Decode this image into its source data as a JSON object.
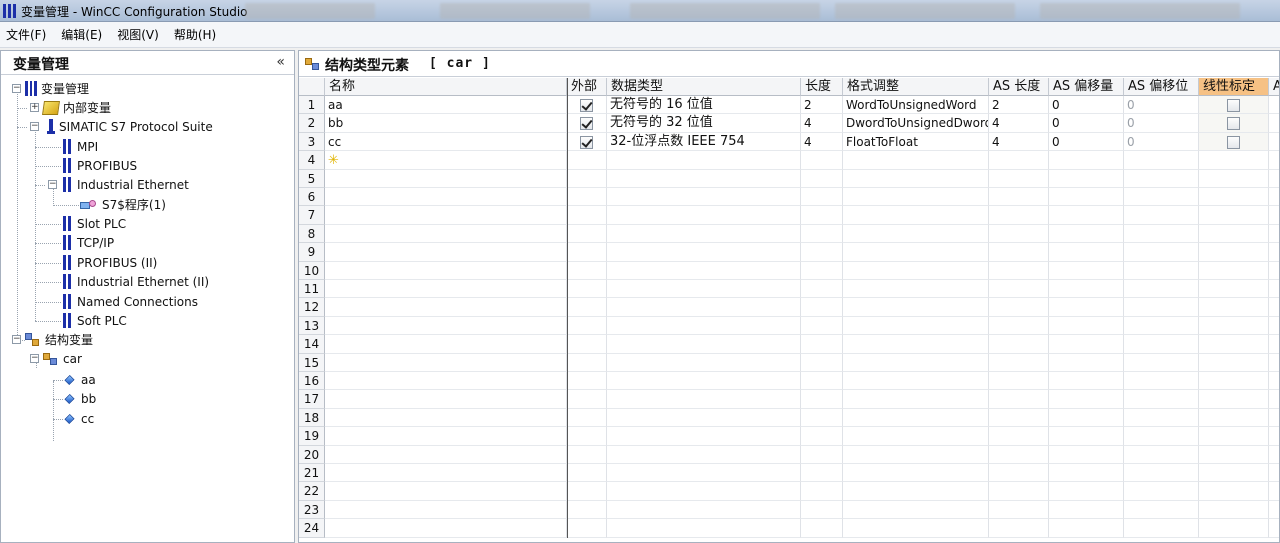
{
  "window": {
    "title": "变量管理 - WinCC Configuration Studio"
  },
  "menu": [
    "文件(F)",
    "编辑(E)",
    "视图(V)",
    "帮助(H)"
  ],
  "left_pane": {
    "title": "变量管理",
    "collapse_glyph": "«",
    "tree": [
      {
        "label": "变量管理",
        "icon": "tag-management-icon"
      },
      {
        "label": "内部变量",
        "icon": "internal-tags-icon"
      },
      {
        "label": "SIMATIC S7 Protocol Suite",
        "icon": "driver-icon"
      },
      {
        "label": "MPI",
        "icon": "channel-icon"
      },
      {
        "label": "PROFIBUS",
        "icon": "channel-icon"
      },
      {
        "label": "Industrial Ethernet",
        "icon": "channel-icon"
      },
      {
        "label": "S7$程序(1)",
        "icon": "connection-icon"
      },
      {
        "label": "Slot PLC",
        "icon": "channel-icon"
      },
      {
        "label": "TCP/IP",
        "icon": "channel-icon"
      },
      {
        "label": "PROFIBUS (II)",
        "icon": "channel-icon"
      },
      {
        "label": "Industrial Ethernet (II)",
        "icon": "channel-icon"
      },
      {
        "label": "Named Connections",
        "icon": "channel-icon"
      },
      {
        "label": "Soft PLC",
        "icon": "channel-icon"
      },
      {
        "label": "结构变量",
        "icon": "structure-tags-icon"
      },
      {
        "label": "car",
        "icon": "structure-type-icon"
      },
      {
        "label": "aa",
        "icon": "element-icon"
      },
      {
        "label": "bb",
        "icon": "element-icon"
      },
      {
        "label": "cc",
        "icon": "element-icon"
      }
    ]
  },
  "right_pane": {
    "title": "结构类型元素",
    "structure_name": "[ car ]",
    "columns": [
      "名称",
      "外部",
      "数据类型",
      "长度",
      "格式调整",
      "AS 长度",
      "AS 偏移量",
      "AS 偏移位",
      "线性标定",
      "AS"
    ],
    "rows": [
      {
        "num": "1",
        "name": "aa",
        "external": true,
        "type": "无符号的 16 位值",
        "length": "2",
        "format": "WordToUnsignedWord",
        "as_length": "2",
        "as_offset": "0",
        "as_bit": "0",
        "linear": false
      },
      {
        "num": "2",
        "name": "bb",
        "external": true,
        "type": "无符号的 32 位值",
        "length": "4",
        "format": "DwordToUnsignedDword",
        "as_length": "4",
        "as_offset": "0",
        "as_bit": "0",
        "linear": false
      },
      {
        "num": "3",
        "name": "cc",
        "external": true,
        "type": "32-位浮点数 IEEE 754",
        "length": "4",
        "format": "FloatToFloat",
        "as_length": "4",
        "as_offset": "0",
        "as_bit": "0",
        "linear": false
      }
    ],
    "new_row_num": "4",
    "new_row_icon": "✳",
    "empty_row_nums": [
      "5",
      "6",
      "7",
      "8",
      "9",
      "10",
      "11",
      "12",
      "13",
      "14",
      "15",
      "16",
      "17",
      "18",
      "19",
      "20",
      "21",
      "22",
      "23",
      "24"
    ]
  }
}
